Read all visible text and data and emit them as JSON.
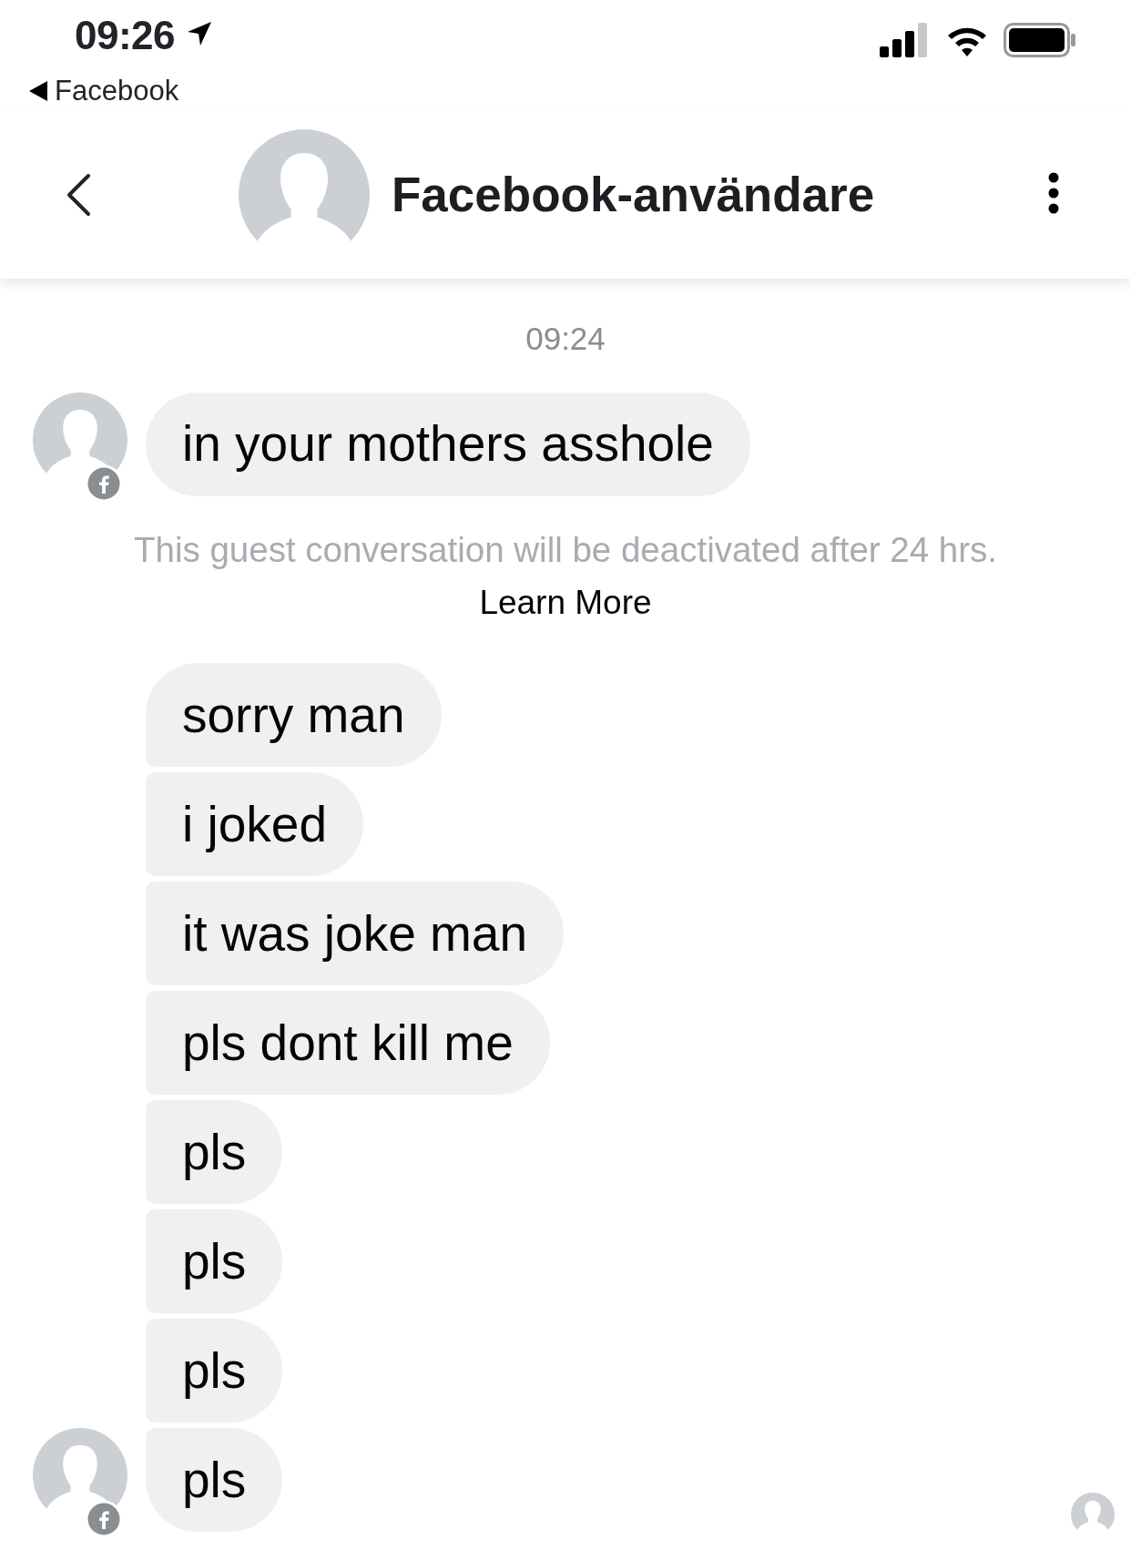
{
  "status_bar": {
    "time": "09:26",
    "back_app": "Facebook"
  },
  "header": {
    "title": "Facebook-användare"
  },
  "conversation": [
    {
      "kind": "timestamp",
      "text": "09:24"
    },
    {
      "kind": "group",
      "messages": [
        "in your mothers asshole"
      ]
    },
    {
      "kind": "notice",
      "text": "This guest conversation will be deactivated after 24 hrs.",
      "link": "Learn More"
    },
    {
      "kind": "group",
      "messages": [
        "sorry man",
        "i joked",
        "it was joke man",
        "pls dont kill me",
        "pls",
        "pls",
        "pls",
        "pls"
      ]
    }
  ]
}
